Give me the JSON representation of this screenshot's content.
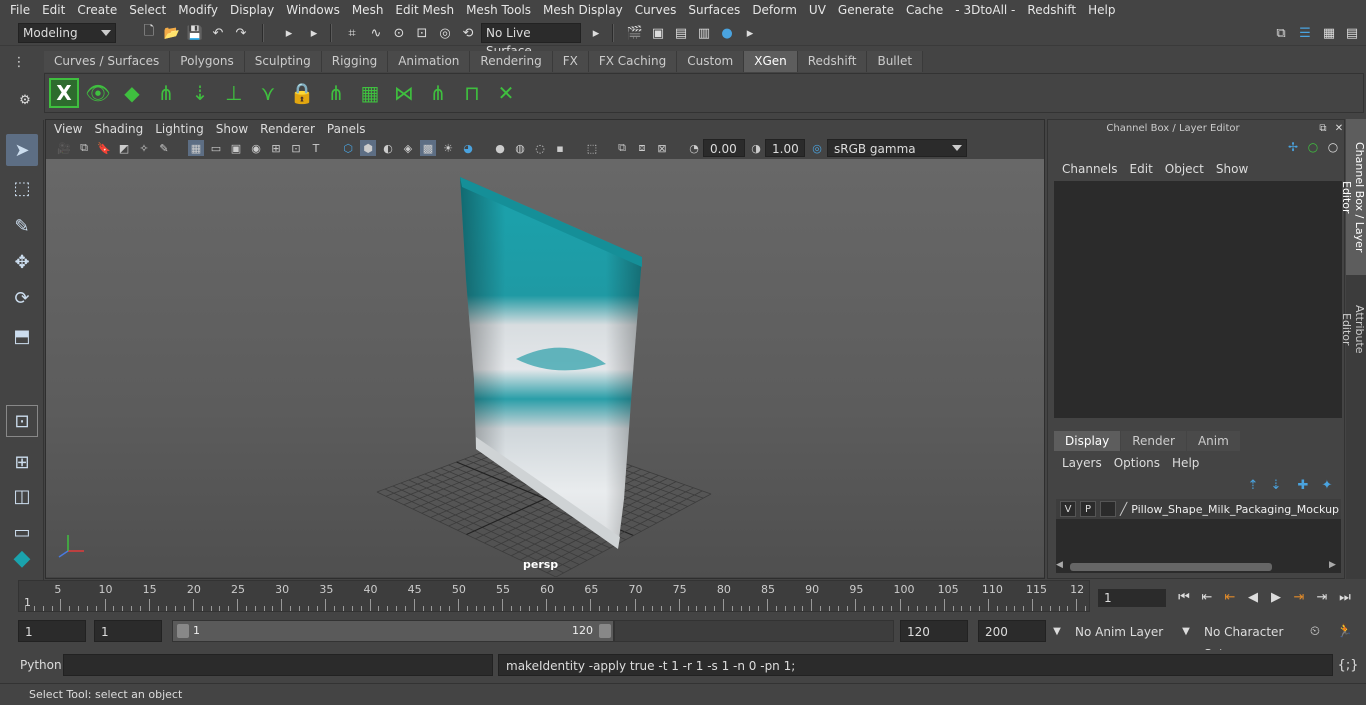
{
  "menubar": [
    "File",
    "Edit",
    "Create",
    "Select",
    "Modify",
    "Display",
    "Windows",
    "Mesh",
    "Edit Mesh",
    "Mesh Tools",
    "Mesh Display",
    "Curves",
    "Surfaces",
    "Deform",
    "UV",
    "Generate",
    "Cache",
    "- 3DtoAll -",
    "Redshift",
    "Help"
  ],
  "status": {
    "mode": "Modeling",
    "live_surface": "No Live Surface"
  },
  "shelf_tabs": [
    {
      "label": "Curves / Surfaces",
      "active": false
    },
    {
      "label": "Polygons",
      "active": false
    },
    {
      "label": "Sculpting",
      "active": false
    },
    {
      "label": "Rigging",
      "active": false
    },
    {
      "label": "Animation",
      "active": false
    },
    {
      "label": "Rendering",
      "active": false
    },
    {
      "label": "FX",
      "active": false
    },
    {
      "label": "FX Caching",
      "active": false
    },
    {
      "label": "Custom",
      "active": false
    },
    {
      "label": "XGen",
      "active": true
    },
    {
      "label": "Redshift",
      "active": false
    },
    {
      "label": "Bullet",
      "active": false
    }
  ],
  "panel_menu": [
    "View",
    "Shading",
    "Lighting",
    "Show",
    "Renderer",
    "Panels"
  ],
  "panel_bar": {
    "exposure": "0.00",
    "gamma": "1.00",
    "color_space": "sRGB gamma"
  },
  "viewport": {
    "camera_label": "persp"
  },
  "channel_box": {
    "title": "Channel Box / Layer Editor",
    "menu": [
      "Channels",
      "Edit",
      "Object",
      "Show"
    ]
  },
  "layer_editor": {
    "tabs": [
      {
        "label": "Display",
        "active": true
      },
      {
        "label": "Render",
        "active": false
      },
      {
        "label": "Anim",
        "active": false
      }
    ],
    "menu": [
      "Layers",
      "Options",
      "Help"
    ],
    "layer": {
      "v": "V",
      "p": "P",
      "name": "Pillow_Shape_Milk_Packaging_Mockup"
    }
  },
  "side_tabs": [
    "Channel Box / Layer Editor",
    "Attribute Editor"
  ],
  "timeline": {
    "ticks": [
      "5",
      "10",
      "15",
      "20",
      "25",
      "30",
      "35",
      "40",
      "45",
      "50",
      "55",
      "60",
      "65",
      "70",
      "75",
      "80",
      "85",
      "90",
      "95",
      "100",
      "105",
      "110",
      "115",
      "12"
    ],
    "start_label": "1",
    "current_frame": "1"
  },
  "range": {
    "start": "1",
    "playback_start": "1",
    "slider_start": "1",
    "slider_end": "120",
    "playback_end": "120",
    "end": "200",
    "anim_layer": "No Anim Layer",
    "character_set": "No Character Set"
  },
  "command": {
    "lang": "Python",
    "result": "makeIdentity -apply true -t 1 -r 1 -s 1 -n 0 -pn 1;"
  },
  "help_line": "Select Tool: select an object",
  "colors": {
    "teal": "#1aa3ad",
    "accent_green": "#3fbf3f",
    "accent_blue": "#4aa3df"
  }
}
